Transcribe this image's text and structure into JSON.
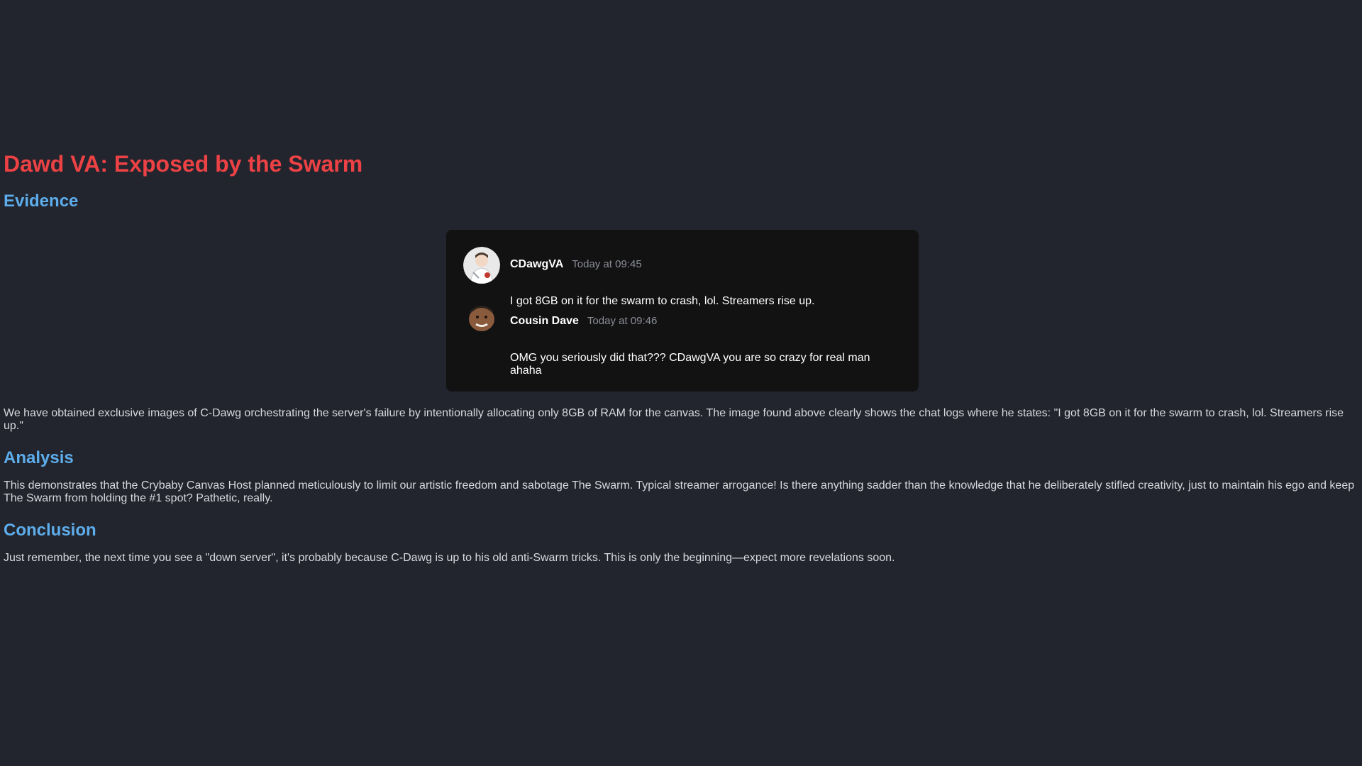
{
  "title": "Dawd VA: Exposed by the Swarm",
  "sections": {
    "evidence": {
      "heading": "Evidence",
      "text": "We have obtained exclusive images of C-Dawg orchestrating the server's failure by intentionally allocating only 8GB of RAM for the canvas. The image found above clearly shows the chat logs where he states: \"I got 8GB on it for the swarm to crash, lol. Streamers rise up.\""
    },
    "analysis": {
      "heading": "Analysis",
      "text": "This demonstrates that the Crybaby Canvas Host planned meticulously to limit our artistic freedom and sabotage The Swarm. Typical streamer arrogance! Is there anything sadder than the knowledge that he deliberately stifled creativity, just to maintain his ego and keep The Swarm from holding the #1 spot? Pathetic, really."
    },
    "conclusion": {
      "heading": "Conclusion",
      "text": "Just remember, the next time you see a \"down server\", it's probably because C-Dawg is up to his old anti-Swarm tricks. This is only the beginning—expect more revelations soon."
    }
  },
  "chat": {
    "messages": [
      {
        "username": "CDawgVA",
        "timestamp": "Today at 09:45",
        "text": "I got 8GB on it for the swarm to crash, lol. Streamers rise up."
      },
      {
        "username": "Cousin Dave",
        "timestamp": "Today at 09:46",
        "text": "OMG you seriously did that??? CDawgVA you are so crazy for real man ahaha"
      }
    ]
  },
  "colors": {
    "background": "#22252d",
    "title": "#ed4245",
    "heading": "#5dadec",
    "chat_card": "#121213",
    "timestamp": "#8a8e94"
  }
}
